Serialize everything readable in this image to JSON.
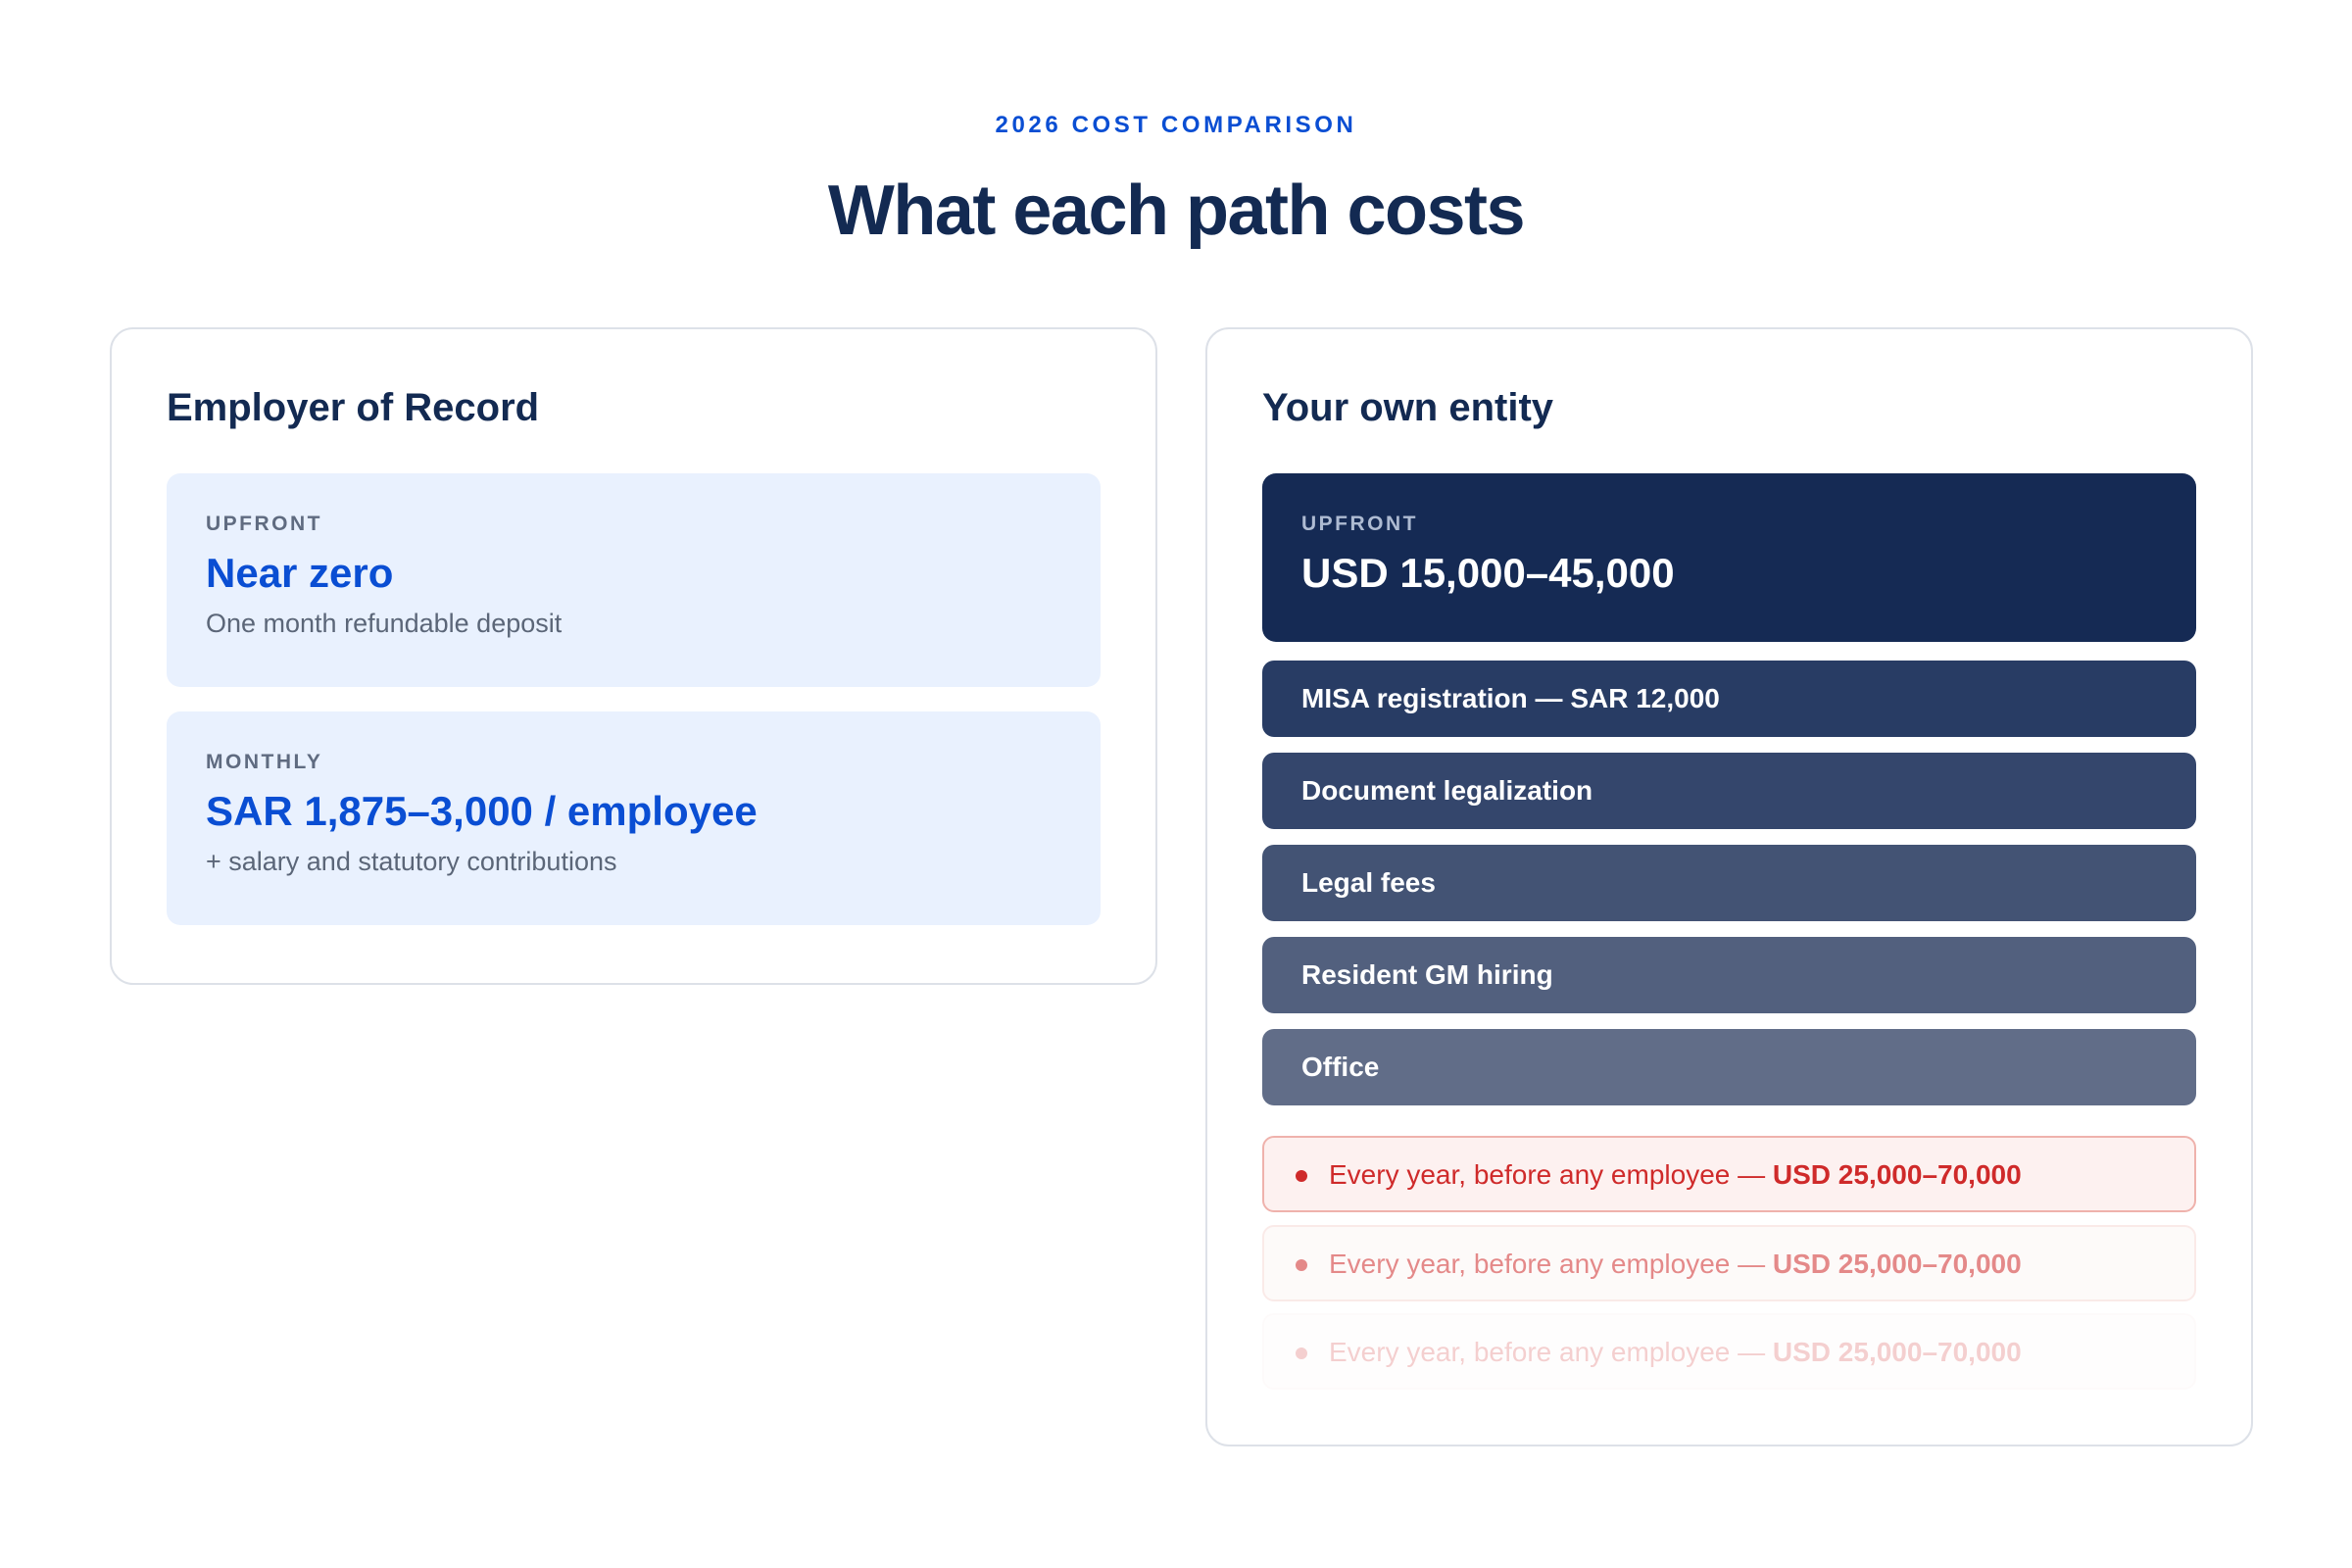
{
  "header": {
    "eyebrow": "2026 COST COMPARISON",
    "title": "What each path costs"
  },
  "eor": {
    "title": "Employer of Record",
    "upfront": {
      "label": "UPFRONT",
      "value": "Near zero",
      "note": "One month refundable deposit"
    },
    "monthly": {
      "label": "MONTHLY",
      "value": "SAR 1,875–3,000 / employee",
      "note": "+ salary and statutory contributions"
    }
  },
  "entity": {
    "title": "Your own entity",
    "upfront": {
      "label": "UPFRONT",
      "value": "USD 15,000–45,000"
    },
    "items": [
      "MISA registration — SAR 12,000",
      "Document legalization",
      "Legal fees",
      "Resident GM hiring",
      "Office"
    ],
    "recurring": [
      {
        "text": "Every year, before any employee — ",
        "amount": "USD 25,000–70,000"
      },
      {
        "text": "Every year, before any employee — ",
        "amount": "USD 25,000–70,000"
      },
      {
        "text": "Every year, before any employee — ",
        "amount": "USD 25,000–70,000"
      }
    ]
  },
  "colors": {
    "accent": "#0a4ed3",
    "navy": "#152a54",
    "alert": "#cf2a2a"
  }
}
